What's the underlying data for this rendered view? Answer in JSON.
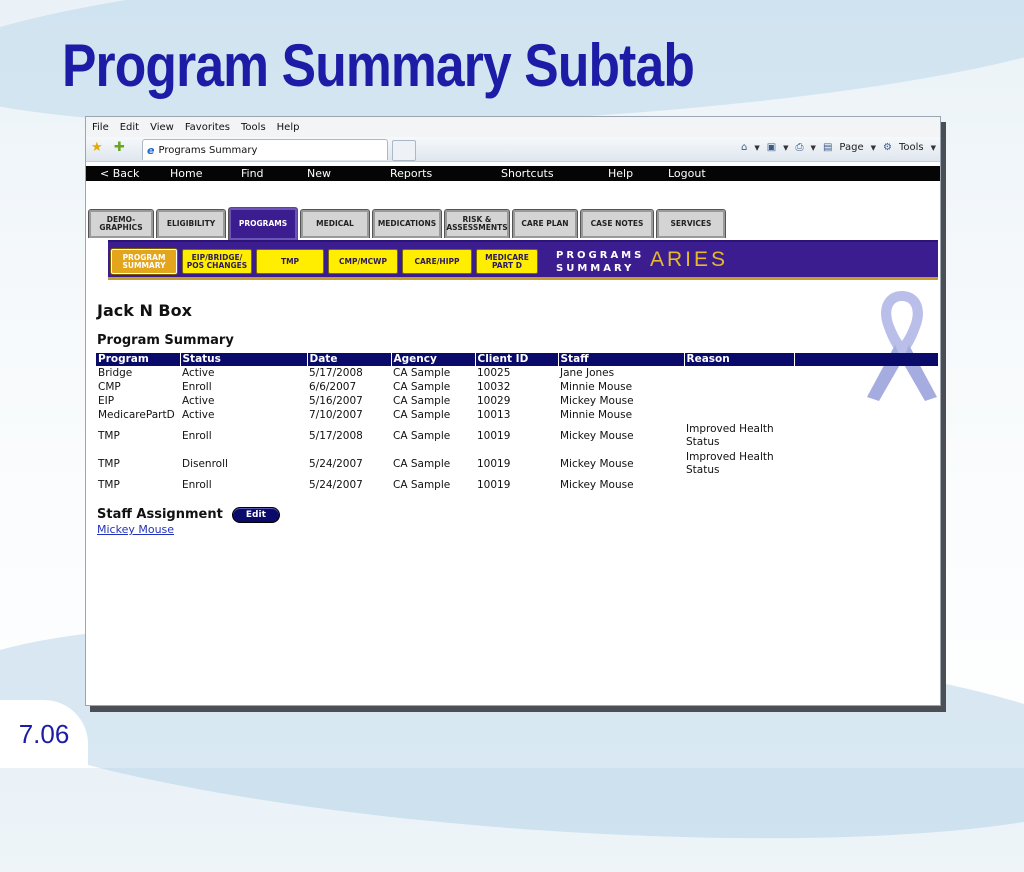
{
  "slide": {
    "title": "Program Summary Subtab",
    "number": "7.06"
  },
  "browser": {
    "menu": [
      "File",
      "Edit",
      "View",
      "Favorites",
      "Tools",
      "Help"
    ],
    "tab_title": "Programs Summary",
    "toolbar_right": {
      "page_label": "Page",
      "tools_label": "Tools"
    }
  },
  "app_nav": [
    "< Back",
    "Home",
    "Find",
    "New",
    "Reports",
    "Shortcuts",
    "Help",
    "Logout"
  ],
  "main_tabs": [
    "DEMO-\nGRAPHICS",
    "ELIGIBILITY",
    "PROGRAMS",
    "MEDICAL",
    "MEDICATIONS",
    "RISK &\nASSESSMENTS",
    "CARE PLAN",
    "CASE NOTES",
    "SERVICES"
  ],
  "main_tab_active": "PROGRAMS",
  "sub_tabs": [
    "PROGRAM\nSUMMARY",
    "EIP/BRIDGE/\nPOS CHANGES",
    "TMP",
    "CMP/MCWP",
    "CARE/HIPP",
    "MEDICARE\nPART D"
  ],
  "sub_tab_active": "PROGRAM\nSUMMARY",
  "sub_header": {
    "line1": "PROGRAMS",
    "line2": "SUMMARY",
    "brand": "ARIES"
  },
  "client": {
    "name": "Jack N Box"
  },
  "program_summary": {
    "title": "Program Summary",
    "columns": [
      "Program",
      "Status",
      "Date",
      "Agency",
      "Client ID",
      "Staff",
      "Reason",
      ""
    ],
    "rows": [
      [
        "Bridge",
        "Active",
        "5/17/2008",
        "CA Sample",
        "10025",
        "Jane Jones",
        "",
        ""
      ],
      [
        "CMP",
        "Enroll",
        "6/6/2007",
        "CA Sample",
        "10032",
        "Minnie Mouse",
        "",
        ""
      ],
      [
        "EIP",
        "Active",
        "5/16/2007",
        "CA Sample",
        "10029",
        "Mickey Mouse",
        "",
        ""
      ],
      [
        "MedicarePartD",
        "Active",
        "7/10/2007",
        "CA Sample",
        "10013",
        "Minnie Mouse",
        "",
        ""
      ],
      [
        "TMP",
        "Enroll",
        "5/17/2008",
        "CA Sample",
        "10019",
        "Mickey Mouse",
        "Improved Health Status",
        ""
      ],
      [
        "TMP",
        "Disenroll",
        "5/24/2007",
        "CA Sample",
        "10019",
        "Mickey Mouse",
        "Improved Health Status",
        ""
      ],
      [
        "TMP",
        "Enroll",
        "5/24/2007",
        "CA Sample",
        "10019",
        "Mickey Mouse",
        "",
        ""
      ]
    ]
  },
  "staff_assignment": {
    "title": "Staff Assignment",
    "edit_label": "Edit",
    "staff": "Mickey Mouse"
  }
}
